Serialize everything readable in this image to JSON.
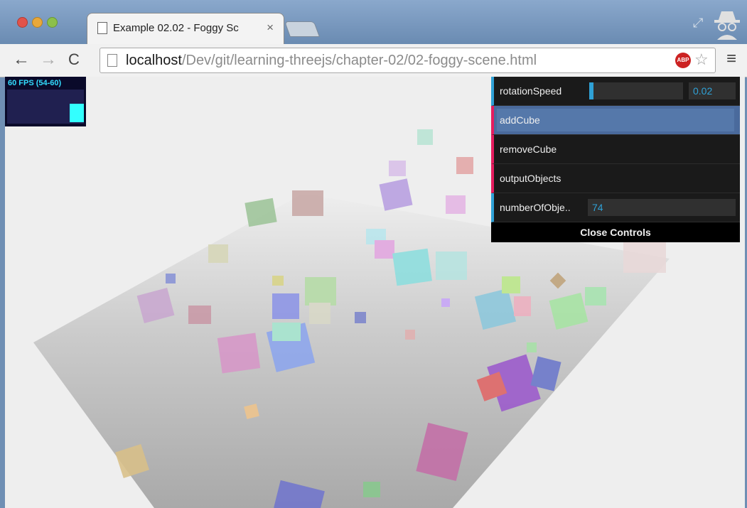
{
  "browser": {
    "tab_title": "Example 02.02 - Foggy Sc",
    "tab_close": "×",
    "url_host": "localhost",
    "url_path": "/Dev/git/learning-threejs/chapter-02/02-foggy-scene.html",
    "abp_label": "ABP",
    "icons": [
      "back-icon",
      "forward-icon",
      "reload-icon",
      "page-icon",
      "star-icon",
      "menu-icon",
      "fullscreen-icon",
      "incognito-icon"
    ]
  },
  "stats": {
    "fps_text": "60 FPS (54-60)",
    "fps_fill": 0.55
  },
  "gui": {
    "rotation_label": "rotationSpeed",
    "rotation_value": "0.02",
    "add_label": "addCube",
    "remove_label": "removeCube",
    "output_label": "outputObjects",
    "number_label": "numberOfObje..",
    "number_value": "74",
    "close_label": "Close Controls"
  },
  "colors": {
    "gui_bg": "#1a1a1a",
    "number_accent": "#2fa1d6",
    "function_accent": "#e61d5f",
    "highlight": "#4a6a9c"
  }
}
